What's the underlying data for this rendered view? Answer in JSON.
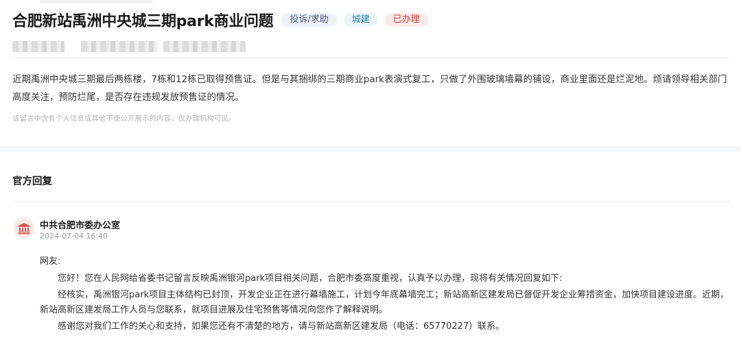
{
  "post": {
    "title": "合肥新站禹洲中央城三期park商业问题",
    "tags": {
      "type": "投诉/求助",
      "category": "城建",
      "status": "已办理"
    },
    "content": "近期禹洲中央城三期最后两栋楼，7栋和12栋已取得预售证。但是与其捆绑的三期商业park表演式复工，只做了外围玻璃墙幕的铺设，商业里面还是烂泥地。烦请领导相关部门高度关注，预防烂尾，是否存在违规发放预售证的情况。",
    "privacy_note": "该留言中含有个人信息或其他不便公开展示的内容，仅办理机构可见。"
  },
  "reply_section": {
    "heading": "官方回复",
    "org_name": "中共合肥市委办公室",
    "org_icon": "government-building-icon",
    "timestamp": "2024-07-04 16:40",
    "greeting": "网友:",
    "paragraphs": [
      "您好！您在人民网给省委书记留言反映禹洲银河park项目相关问题，合肥市委高度重视，认真予以办理，现将有关情况回复如下:",
      "经核实，禹洲银河park项目主体结构已封顶，开发企业正在进行幕墙施工，计划今年底幕墙完工；新站高新区建发局已督促开发企业筹措资金，加快项目建设进度。近期，新站高新区建发局工作人员与您联系，就项目进展及住宅预售等情况向您作了解释说明。",
      "感谢您对我们工作的关心和支持，如果您还有不清楚的地方，请与新站高新区建发局（电话：65770227）联系。"
    ]
  },
  "colors": {
    "tag_type_bg": "#eef1f8",
    "tag_category_bg": "#e8f5f8",
    "tag_status_bg": "#fdeaea",
    "status_text": "#d23838",
    "avatar_icon": "#d9534f"
  }
}
